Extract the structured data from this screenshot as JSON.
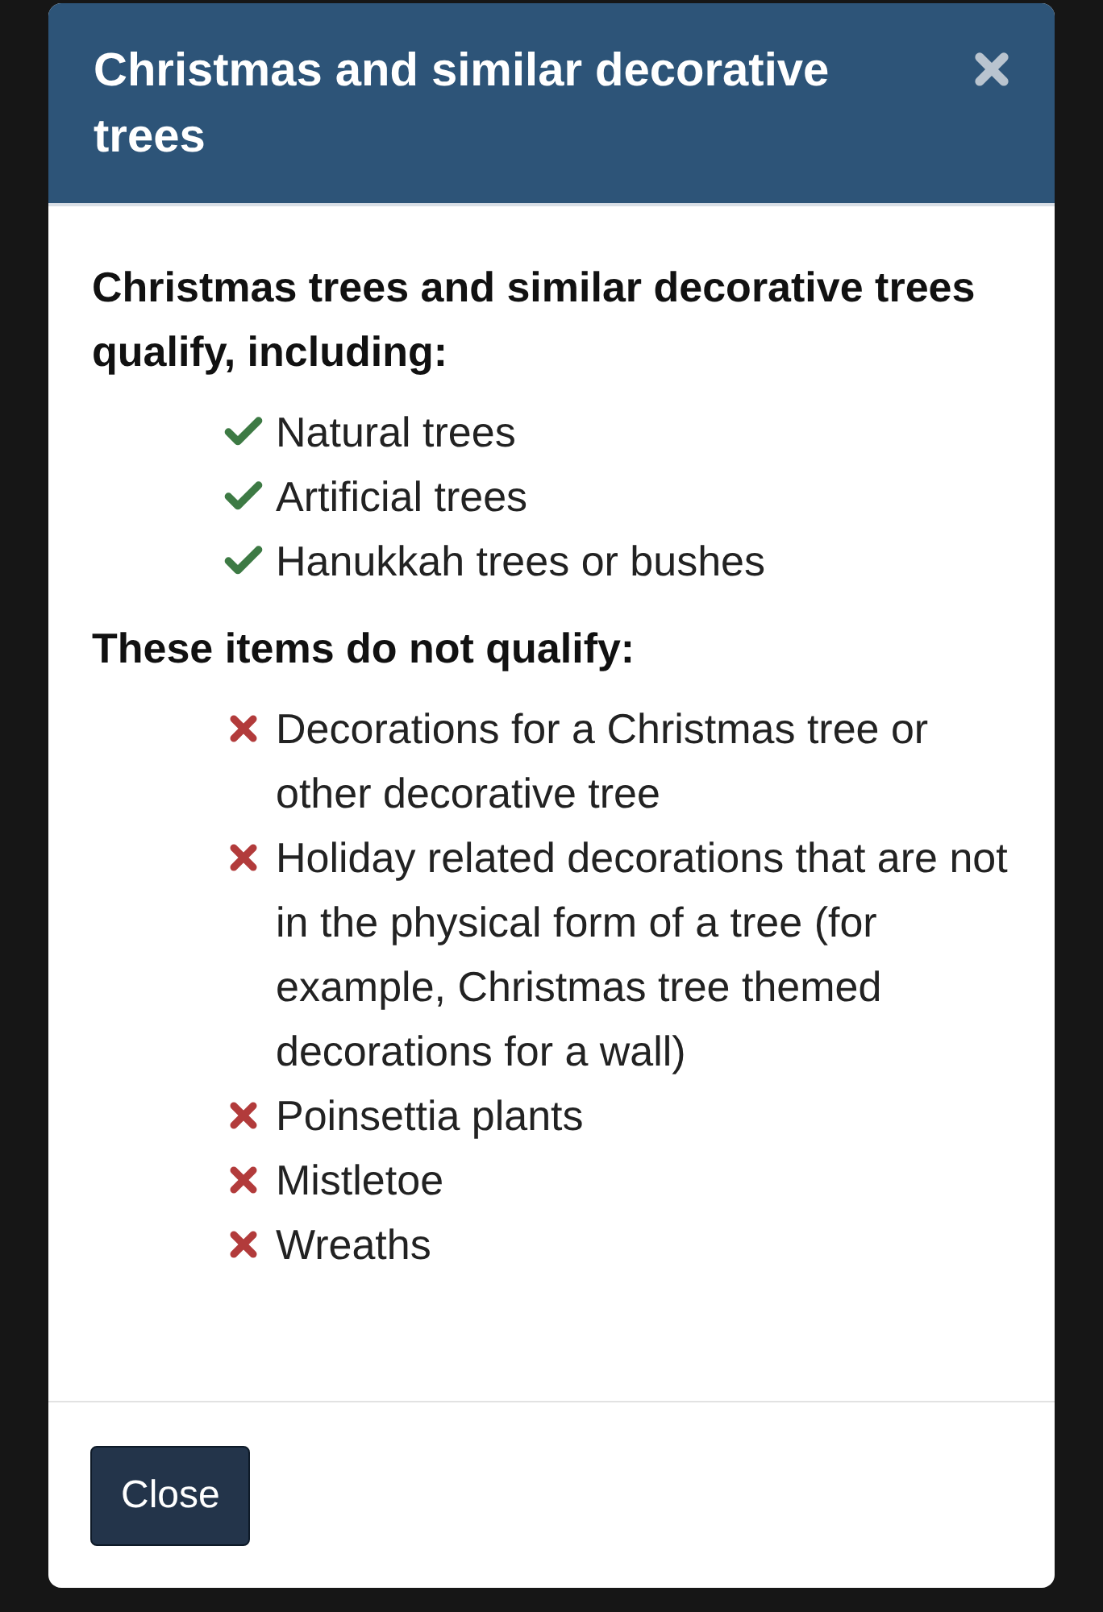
{
  "dialog": {
    "title": "Christmas and similar decorative trees"
  },
  "sections": [
    {
      "heading": "Christmas trees and similar decorative trees qualify, including:",
      "items": [
        {
          "kind": "yes",
          "text": "Natural trees"
        },
        {
          "kind": "yes",
          "text": "Artificial trees"
        },
        {
          "kind": "yes",
          "text": "Hanukkah trees or bushes"
        }
      ]
    },
    {
      "heading": "These items do not qualify:",
      "items": [
        {
          "kind": "no",
          "text": "Decorations for a Christmas tree or other decorative tree"
        },
        {
          "kind": "no",
          "text": "Holiday related decorations that are not in the physical form of a tree (for example, Christmas tree themed decorations for a wall)"
        },
        {
          "kind": "no",
          "text": "Poinsettia plants"
        },
        {
          "kind": "no",
          "text": "Mistletoe"
        },
        {
          "kind": "no",
          "text": "Wreaths"
        }
      ]
    }
  ],
  "buttons": [
    "Close"
  ]
}
